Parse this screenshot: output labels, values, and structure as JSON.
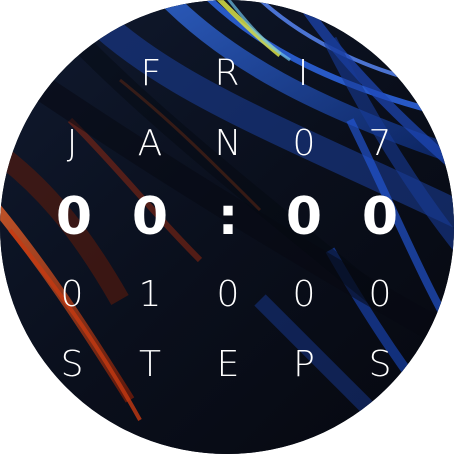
{
  "watch": {
    "day": [
      "F",
      "R",
      "I"
    ],
    "date": [
      "J",
      "A",
      "N",
      "0",
      "7"
    ],
    "time": [
      "0",
      "0",
      ":",
      "0",
      "0"
    ],
    "steps": [
      "0",
      "1",
      "0",
      "0",
      "0"
    ],
    "steps_label": [
      "S",
      "T",
      "E",
      "P",
      "S"
    ]
  },
  "colors": {
    "text": "#ffffff",
    "background": "#0a0f1c",
    "accent_blue": "#1f5bd6",
    "accent_orange": "#d2461c"
  }
}
